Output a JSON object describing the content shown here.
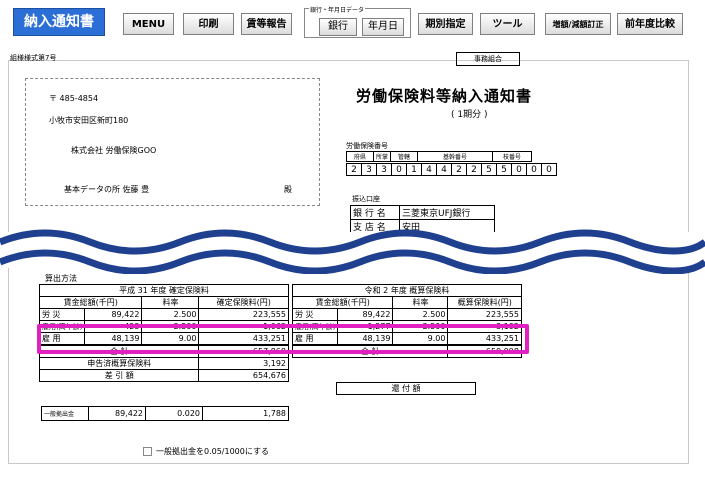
{
  "toolbar": {
    "notice_btn": "納入通知書",
    "menu_btn": "MENU",
    "print_btn": "印刷",
    "wage_btn": "賃等報告",
    "group_label": "銀行・年月日データ",
    "bank_btn": "銀行",
    "date_btn": "年月日",
    "period_btn": "期別指定",
    "tools_btn": "ツール",
    "increase_btn": "増額/減額訂正",
    "compare_btn": "前年度比較"
  },
  "form_no": "組様様式第7号",
  "office_tag": "事務組合",
  "address": {
    "postal": "〒 485-4854",
    "line1": "小牧市安田区新町180",
    "company": "株式会社 労働保険GOO",
    "person": "基本データの所 佐藤 豊",
    "honorific": "殿"
  },
  "doc_title": "労働保険料等納入通知書",
  "period": "( 1期分 )",
  "insurance_no": {
    "label": "労働保険番号",
    "headers": [
      "府県",
      "所掌",
      "管轄",
      "基幹番号",
      "枝番号"
    ],
    "digits": [
      "2",
      "3",
      "3",
      "0",
      "1",
      "4",
      "4",
      "2",
      "2",
      "5",
      "5",
      "0",
      "0",
      "0"
    ]
  },
  "bank": {
    "label": "振込口座",
    "bank_key": "銀 行 名",
    "bank_val": "三菱東京UFJ銀行",
    "branch_key": "支 店 名",
    "branch_val": "安田"
  },
  "calc": {
    "title": "算出方法",
    "left_header": "平成 31 年度 確定保険料",
    "right_header": "令和 2 年度 概算保険料",
    "col_wage": "賃金総額(千円)",
    "col_rate": "料率",
    "col_fixed": "確定保険料(円)",
    "col_est": "概算保険料(円)",
    "rows": [
      {
        "label": "労 災",
        "wage": "89,422",
        "rate": "2.500",
        "amount": "223,555",
        "label2": "労 災",
        "wage2": "89,422",
        "rate2": "2.500",
        "amount2": "223,555"
      },
      {
        "label": "雇用(高年齢)",
        "wage": "423",
        "rate": "2.500",
        "amount": "1,062",
        "label2": "雇用(高年齢)",
        "wage2": "1,277",
        "rate2": "2.500",
        "amount2": "3,192"
      },
      {
        "label": "雇 用",
        "wage": "48,139",
        "rate": "9.00",
        "amount": "433,251",
        "label2": "雇 用",
        "wage2": "48,139",
        "rate2": "9.00",
        "amount2": "433,251"
      }
    ],
    "total_label": "合 計",
    "total_left": "657,868",
    "total_right": "659,998",
    "declared_label": "申告済概算保険料",
    "declared_val": "3,192",
    "diff_label": "差 引 額",
    "diff_val": "654,676",
    "refund_label": "還 付 額",
    "general_label": "一般拠出金",
    "general_wage": "89,422",
    "general_rate": "0.020",
    "general_amount": "1,788"
  },
  "checkbox_label": "一般拠出金を0.05/1000にする",
  "colors": {
    "accent": "#2b6fd6",
    "highlight": "#e020c0",
    "wave": "#1f3f8f"
  }
}
